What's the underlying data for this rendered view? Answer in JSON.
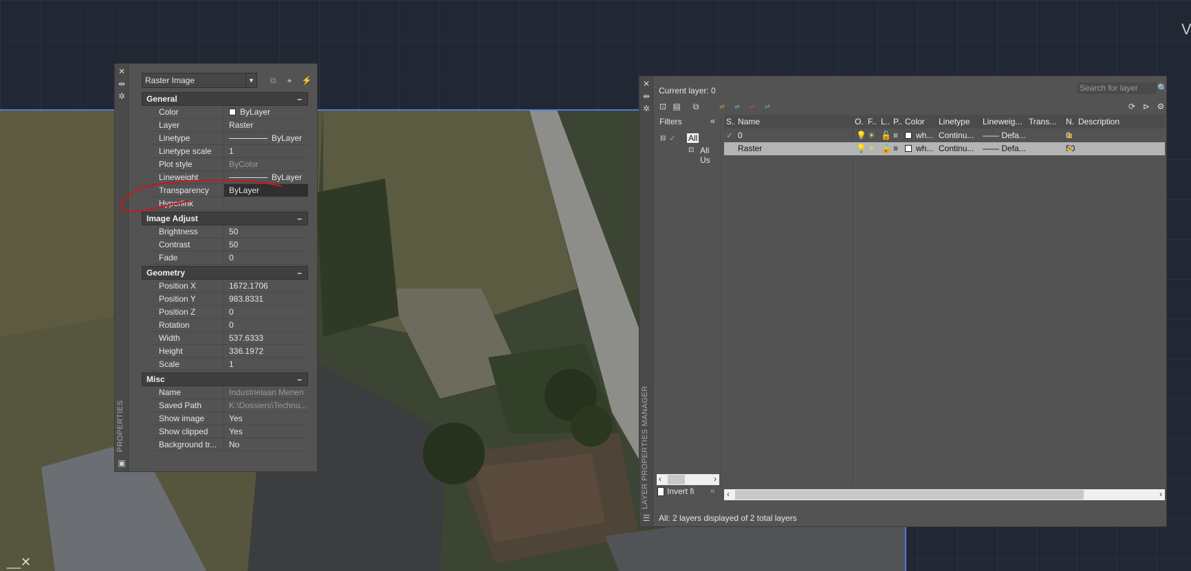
{
  "properties": {
    "palette_title": "PROPERTIES",
    "object_type": "Raster Image",
    "sections": [
      {
        "title": "General",
        "collapse": "–",
        "rows": [
          {
            "label": "Color",
            "value": "ByLayer",
            "kind": "swatch"
          },
          {
            "label": "Layer",
            "value": "Raster"
          },
          {
            "label": "Linetype",
            "value": "ByLayer",
            "kind": "line"
          },
          {
            "label": "Linetype scale",
            "value": "1"
          },
          {
            "label": "Plot style",
            "value": "ByColor",
            "kind": "dim"
          },
          {
            "label": "Lineweight",
            "value": "ByLayer",
            "kind": "line"
          },
          {
            "label": "Transparency",
            "value": "ByLayer",
            "kind": "active"
          },
          {
            "label": "Hyperlink",
            "value": ""
          }
        ]
      },
      {
        "title": "Image Adjust",
        "collapse": "–",
        "rows": [
          {
            "label": "Brightness",
            "value": "50"
          },
          {
            "label": "Contrast",
            "value": "50"
          },
          {
            "label": "Fade",
            "value": "0"
          }
        ]
      },
      {
        "title": "Geometry",
        "collapse": "–",
        "rows": [
          {
            "label": "Position X",
            "value": "1672.1706"
          },
          {
            "label": "Position Y",
            "value": "983.8331"
          },
          {
            "label": "Position Z",
            "value": "0"
          },
          {
            "label": "Rotation",
            "value": "0"
          },
          {
            "label": "Width",
            "value": "537.6333"
          },
          {
            "label": "Height",
            "value": "336.1972"
          },
          {
            "label": "Scale",
            "value": "1"
          }
        ]
      },
      {
        "title": "Misc",
        "collapse": "–",
        "rows": [
          {
            "label": "Name",
            "value": "Industrielaan Menen",
            "kind": "dim"
          },
          {
            "label": "Saved Path",
            "value": "K:\\Dossiers\\Technu...",
            "kind": "dim"
          },
          {
            "label": "Show image",
            "value": "Yes"
          },
          {
            "label": "Show clipped",
            "value": "Yes"
          },
          {
            "label": "Background tr...",
            "value": "No"
          }
        ]
      }
    ]
  },
  "layers": {
    "palette_title": "LAYER PROPERTIES MANAGER",
    "current_layer": "Current layer: 0",
    "search_placeholder": "Search for layer",
    "filters_label": "Filters",
    "filter_tree": [
      "All",
      "All Us"
    ],
    "invert_filter": "Invert fi",
    "columns": [
      "S..",
      "Name",
      "O.",
      "F..",
      "L..",
      "P..",
      "Color",
      "Linetype",
      "Lineweig...",
      "Trans...",
      "N.",
      "Description"
    ],
    "rows": [
      {
        "status": "current",
        "name": "0",
        "color": "wh...",
        "linetype": "Continu...",
        "lineweight": "Defa...",
        "transparency": "0"
      },
      {
        "status": "layer",
        "name": "Raster",
        "color": "wh...",
        "linetype": "Continu...",
        "lineweight": "Defa...",
        "transparency": "50",
        "selected": true
      }
    ],
    "status_text": "All: 2 layers displayed of 2 total layers"
  },
  "colors": {
    "annotation": "#d0141b",
    "selection": "#b4b4b4",
    "ucs_line": "#4f7bd6"
  }
}
